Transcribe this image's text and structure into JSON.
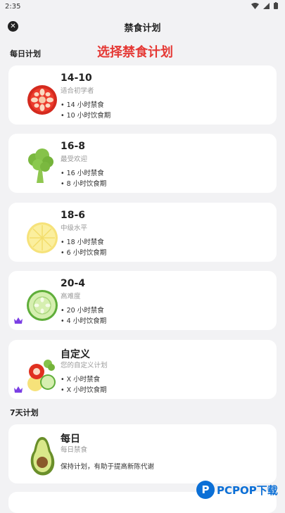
{
  "status_bar": {
    "time": "2:35"
  },
  "header": {
    "title": "禁食计划"
  },
  "annotation": "选择禁食计划",
  "sections": {
    "daily": "每日计划",
    "weekly": "7天计划"
  },
  "plans": [
    {
      "name": "14-10",
      "subtitle": "适合初学者",
      "bullets": [
        "14 小时禁食",
        "10 小时饮食期"
      ],
      "illustration": "tomato"
    },
    {
      "name": "16-8",
      "subtitle": "最受欢迎",
      "bullets": [
        "16 小时禁食",
        "8 小时饮食期"
      ],
      "illustration": "broccoli"
    },
    {
      "name": "18-6",
      "subtitle": "中级水平",
      "bullets": [
        "18 小时禁食",
        "6 小时饮食期"
      ],
      "illustration": "lemon"
    },
    {
      "name": "20-4",
      "subtitle": "高难度",
      "bullets": [
        "20 小时禁食",
        "4 小时饮食期"
      ],
      "illustration": "cucumber",
      "premium": true
    },
    {
      "name": "自定义",
      "subtitle": "您的自定义计划",
      "bullets": [
        "X 小时禁食",
        "X 小时饮食期"
      ],
      "illustration": "mixed",
      "premium": true
    }
  ],
  "weekly_plan": {
    "name": "每日",
    "subtitle": "每日禁食",
    "description": "保持计划，有助于提高新陈代谢",
    "illustration": "avocado"
  },
  "watermark": "PCPOP下载",
  "colors": {
    "background": "#f2f2f4",
    "card": "#ffffff",
    "annotation": "#e53935",
    "premium": "#7b3fe4",
    "watermark": "#0b6fd6"
  }
}
